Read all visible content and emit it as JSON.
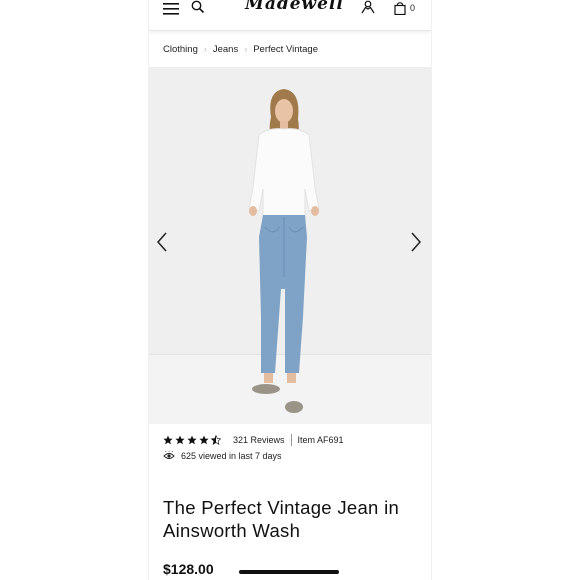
{
  "header": {
    "logo": "Madewell",
    "bag_count": "0",
    "icons": [
      "hamburger-menu-icon",
      "search-icon",
      "account-icon",
      "shopping-bag-icon"
    ]
  },
  "breadcrumb": [
    "Clothing",
    "Jeans",
    "Perfect Vintage"
  ],
  "gallery": {
    "icons": [
      "chevron-left-icon",
      "chevron-right-icon"
    ]
  },
  "product": {
    "rating": 4.5,
    "rating_max": 5,
    "reviews": "321 Reviews",
    "item_number": "Item AF691",
    "views": "625 viewed in last 7 days",
    "title": "The Perfect Vintage Jean in Ainsworth Wash",
    "price": "$128.00"
  },
  "colors": {
    "text": "#111111",
    "gallery_bg": "#efefef",
    "denim": "#7fa3c7"
  }
}
